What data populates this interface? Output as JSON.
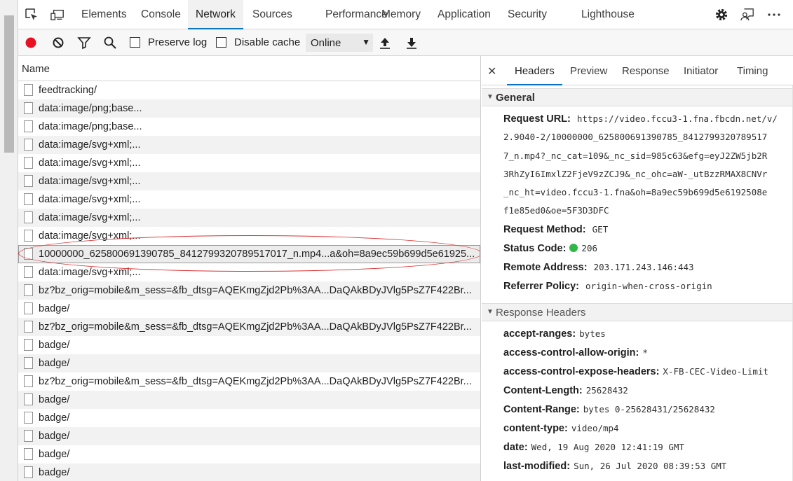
{
  "tabs": [
    {
      "label": "Elements"
    },
    {
      "label": "Console"
    },
    {
      "label": "Network"
    },
    {
      "label": "Sources"
    },
    {
      "label": "Performance"
    },
    {
      "label": "Memory"
    },
    {
      "label": "Application"
    },
    {
      "label": "Security"
    },
    {
      "label": "Lighthouse"
    }
  ],
  "active_tab": "Network",
  "toolbar": {
    "preserve_log_label": "Preserve log",
    "disable_cache_label": "Disable cache",
    "throttle_value": "Online",
    "record_color": "#e81123"
  },
  "requests": {
    "column_name": "Name",
    "rows": [
      {
        "name": "feedtracking/"
      },
      {
        "name": "data:image/png;base..."
      },
      {
        "name": "data:image/png;base..."
      },
      {
        "name": "data:image/svg+xml;..."
      },
      {
        "name": "data:image/svg+xml;..."
      },
      {
        "name": "data:image/svg+xml;..."
      },
      {
        "name": "data:image/svg+xml;..."
      },
      {
        "name": "data:image/svg+xml;..."
      },
      {
        "name": "data:image/svg+xml;..."
      },
      {
        "name": "10000000_625800691390785_8412799320789517017_n.mp4...a&oh=8a9ec59b699d5e61925..."
      },
      {
        "name": "data:image/svg+xml;..."
      },
      {
        "name": "bz?bz_orig=mobile&m_sess=&fb_dtsg=AQEKmgZjd2Pb%3AA...DaQAkBDyJVlg5PsZ7F422Br..."
      },
      {
        "name": "badge/"
      },
      {
        "name": "bz?bz_orig=mobile&m_sess=&fb_dtsg=AQEKmgZjd2Pb%3AA...DaQAkBDyJVlg5PsZ7F422Br..."
      },
      {
        "name": "badge/"
      },
      {
        "name": "badge/"
      },
      {
        "name": "bz?bz_orig=mobile&m_sess=&fb_dtsg=AQEKmgZjd2Pb%3AA...DaQAkBDyJVlg5PsZ7F422Br..."
      },
      {
        "name": "badge/"
      },
      {
        "name": "badge/"
      },
      {
        "name": "badge/"
      },
      {
        "name": "badge/"
      },
      {
        "name": "badge/"
      }
    ]
  },
  "details": {
    "close_glyph": "✕",
    "tabs": [
      {
        "label": "Headers"
      },
      {
        "label": "Preview"
      },
      {
        "label": "Response"
      },
      {
        "label": "Initiator"
      },
      {
        "label": "Timing"
      }
    ],
    "general": {
      "title": "General",
      "request_url_label": "Request URL:",
      "request_url_lines": [
        "https://video.fccu3-1.fna.fbcdn.net/v/",
        "2.9040-2/10000000_625800691390785_8412799320789517",
        "7_n.mp4?_nc_cat=109&_nc_sid=985c63&efg=eyJ2ZW5jb2R",
        "3RhZyI6ImxlZ2FjeV9zZCJ9&_nc_ohc=aW-_utBzzRMAX8CNVr",
        "_nc_ht=video.fccu3-1.fna&oh=8a9ec59b699d5e6192508e",
        "f1e85ed0&oe=5F3D3DFC"
      ],
      "request_method_label": "Request Method:",
      "request_method": "GET",
      "status_code_label": "Status Code:",
      "status_code": "206",
      "status_color": "#2fb845",
      "remote_address_label": "Remote Address:",
      "remote_address": "203.171.243.146:443",
      "referrer_policy_label": "Referrer Policy:",
      "referrer_policy": "origin-when-cross-origin"
    },
    "response_headers": {
      "title": "Response Headers",
      "items": [
        {
          "k": "accept-ranges:",
          "v": "bytes"
        },
        {
          "k": "access-control-allow-origin:",
          "v": "*"
        },
        {
          "k": "access-control-expose-headers:",
          "v": "X-FB-CEC-Video-Limit"
        },
        {
          "k": "Content-Length:",
          "v": "25628432"
        },
        {
          "k": "Content-Range:",
          "v": "bytes 0-25628431/25628432"
        },
        {
          "k": "content-type:",
          "v": "video/mp4"
        },
        {
          "k": "date:",
          "v": "Wed, 19 Aug 2020 12:41:19 GMT"
        },
        {
          "k": "last-modified:",
          "v": "Sun, 26 Jul 2020 08:39:53 GMT"
        }
      ]
    }
  },
  "accent_color": "#0a74c4"
}
